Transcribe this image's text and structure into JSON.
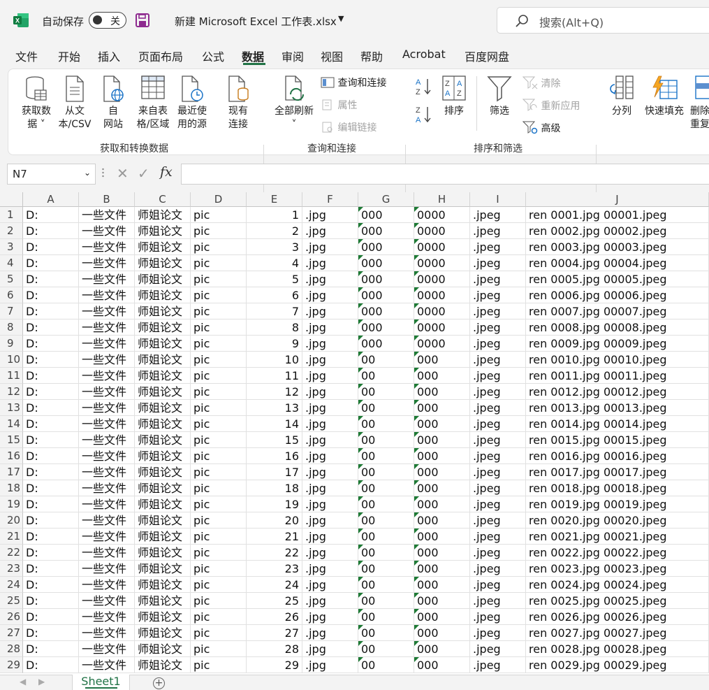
{
  "titlebar": {
    "autosave_label": "自动保存",
    "toggle_state": "关",
    "doc_title": "新建 Microsoft Excel 工作表.xlsx",
    "search_placeholder": "搜索(Alt+Q)",
    "brand_color": "#217346"
  },
  "ribbon_tabs": [
    "文件",
    "开始",
    "插入",
    "页面布局",
    "公式",
    "数据",
    "审阅",
    "视图",
    "帮助",
    "Acrobat",
    "百度网盘"
  ],
  "active_tab": "数据",
  "ribbon": {
    "get_data": [
      "获取数",
      "据 ˅"
    ],
    "from_csv": [
      "从文",
      "本/CSV"
    ],
    "from_web": [
      "自",
      "网站"
    ],
    "from_table": [
      "来自表",
      "格/区域"
    ],
    "recent_sources": [
      "最近使",
      "用的源"
    ],
    "existing_conn": [
      "现有",
      "连接"
    ],
    "group1": "获取和转换数据",
    "refresh_all": [
      "全部刷新",
      "˅"
    ],
    "queries_conn": "查询和连接",
    "properties": "属性",
    "edit_links": "编辑链接",
    "group2": "查询和连接",
    "sort": "排序",
    "filter": "筛选",
    "clear": "清除",
    "reapply": "重新应用",
    "advanced": "高级",
    "group3": "排序和筛选",
    "split": "分列",
    "flash_fill": "快速填充",
    "remove_dup": [
      "删除",
      "重复"
    ]
  },
  "formula_bar": {
    "name_box": "N7",
    "fx": "fx",
    "formula": ""
  },
  "sheet": {
    "columns": [
      "A",
      "B",
      "C",
      "D",
      "E",
      "F",
      "G",
      "H",
      "I",
      "J"
    ],
    "rows": [
      {
        "n": "1",
        "a": "D:",
        "b": "一些文件",
        "c": "师姐论文",
        "d": "pic",
        "e": "1",
        "f": ".jpg",
        "g": "000",
        "h": "0000",
        "i": ".jpeg",
        "j": "ren 0001.jpg 00001.jpeg"
      },
      {
        "n": "2",
        "a": "D:",
        "b": "一些文件",
        "c": "师姐论文",
        "d": "pic",
        "e": "2",
        "f": ".jpg",
        "g": "000",
        "h": "0000",
        "i": ".jpeg",
        "j": "ren 0002.jpg 00002.jpeg"
      },
      {
        "n": "3",
        "a": "D:",
        "b": "一些文件",
        "c": "师姐论文",
        "d": "pic",
        "e": "3",
        "f": ".jpg",
        "g": "000",
        "h": "0000",
        "i": ".jpeg",
        "j": "ren 0003.jpg 00003.jpeg"
      },
      {
        "n": "4",
        "a": "D:",
        "b": "一些文件",
        "c": "师姐论文",
        "d": "pic",
        "e": "4",
        "f": ".jpg",
        "g": "000",
        "h": "0000",
        "i": ".jpeg",
        "j": "ren 0004.jpg 00004.jpeg"
      },
      {
        "n": "5",
        "a": "D:",
        "b": "一些文件",
        "c": "师姐论文",
        "d": "pic",
        "e": "5",
        "f": ".jpg",
        "g": "000",
        "h": "0000",
        "i": ".jpeg",
        "j": "ren 0005.jpg 00005.jpeg"
      },
      {
        "n": "6",
        "a": "D:",
        "b": "一些文件",
        "c": "师姐论文",
        "d": "pic",
        "e": "6",
        "f": ".jpg",
        "g": "000",
        "h": "0000",
        "i": ".jpeg",
        "j": "ren 0006.jpg 00006.jpeg"
      },
      {
        "n": "7",
        "a": "D:",
        "b": "一些文件",
        "c": "师姐论文",
        "d": "pic",
        "e": "7",
        "f": ".jpg",
        "g": "000",
        "h": "0000",
        "i": ".jpeg",
        "j": "ren 0007.jpg 00007.jpeg"
      },
      {
        "n": "8",
        "a": "D:",
        "b": "一些文件",
        "c": "师姐论文",
        "d": "pic",
        "e": "8",
        "f": ".jpg",
        "g": "000",
        "h": "0000",
        "i": ".jpeg",
        "j": "ren 0008.jpg 00008.jpeg"
      },
      {
        "n": "9",
        "a": "D:",
        "b": "一些文件",
        "c": "师姐论文",
        "d": "pic",
        "e": "9",
        "f": ".jpg",
        "g": "000",
        "h": "0000",
        "i": ".jpeg",
        "j": "ren 0009.jpg 00009.jpeg"
      },
      {
        "n": "10",
        "a": "D:",
        "b": "一些文件",
        "c": "师姐论文",
        "d": "pic",
        "e": "10",
        "f": ".jpg",
        "g": "00",
        "h": "000",
        "i": ".jpeg",
        "j": "ren 0010.jpg 00010.jpeg"
      },
      {
        "n": "11",
        "a": "D:",
        "b": "一些文件",
        "c": "师姐论文",
        "d": "pic",
        "e": "11",
        "f": ".jpg",
        "g": "00",
        "h": "000",
        "i": ".jpeg",
        "j": "ren 0011.jpg 00011.jpeg"
      },
      {
        "n": "12",
        "a": "D:",
        "b": "一些文件",
        "c": "师姐论文",
        "d": "pic",
        "e": "12",
        "f": ".jpg",
        "g": "00",
        "h": "000",
        "i": ".jpeg",
        "j": "ren 0012.jpg 00012.jpeg"
      },
      {
        "n": "13",
        "a": "D:",
        "b": "一些文件",
        "c": "师姐论文",
        "d": "pic",
        "e": "13",
        "f": ".jpg",
        "g": "00",
        "h": "000",
        "i": ".jpeg",
        "j": "ren 0013.jpg 00013.jpeg"
      },
      {
        "n": "14",
        "a": "D:",
        "b": "一些文件",
        "c": "师姐论文",
        "d": "pic",
        "e": "14",
        "f": ".jpg",
        "g": "00",
        "h": "000",
        "i": ".jpeg",
        "j": "ren 0014.jpg 00014.jpeg"
      },
      {
        "n": "15",
        "a": "D:",
        "b": "一些文件",
        "c": "师姐论文",
        "d": "pic",
        "e": "15",
        "f": ".jpg",
        "g": "00",
        "h": "000",
        "i": ".jpeg",
        "j": "ren 0015.jpg 00015.jpeg"
      },
      {
        "n": "16",
        "a": "D:",
        "b": "一些文件",
        "c": "师姐论文",
        "d": "pic",
        "e": "16",
        "f": ".jpg",
        "g": "00",
        "h": "000",
        "i": ".jpeg",
        "j": "ren 0016.jpg 00016.jpeg"
      },
      {
        "n": "17",
        "a": "D:",
        "b": "一些文件",
        "c": "师姐论文",
        "d": "pic",
        "e": "17",
        "f": ".jpg",
        "g": "00",
        "h": "000",
        "i": ".jpeg",
        "j": "ren 0017.jpg 00017.jpeg"
      },
      {
        "n": "18",
        "a": "D:",
        "b": "一些文件",
        "c": "师姐论文",
        "d": "pic",
        "e": "18",
        "f": ".jpg",
        "g": "00",
        "h": "000",
        "i": ".jpeg",
        "j": "ren 0018.jpg 00018.jpeg"
      },
      {
        "n": "19",
        "a": "D:",
        "b": "一些文件",
        "c": "师姐论文",
        "d": "pic",
        "e": "19",
        "f": ".jpg",
        "g": "00",
        "h": "000",
        "i": ".jpeg",
        "j": "ren 0019.jpg 00019.jpeg"
      },
      {
        "n": "20",
        "a": "D:",
        "b": "一些文件",
        "c": "师姐论文",
        "d": "pic",
        "e": "20",
        "f": ".jpg",
        "g": "00",
        "h": "000",
        "i": ".jpeg",
        "j": "ren 0020.jpg 00020.jpeg"
      },
      {
        "n": "21",
        "a": "D:",
        "b": "一些文件",
        "c": "师姐论文",
        "d": "pic",
        "e": "21",
        "f": ".jpg",
        "g": "00",
        "h": "000",
        "i": ".jpeg",
        "j": "ren 0021.jpg 00021.jpeg"
      },
      {
        "n": "22",
        "a": "D:",
        "b": "一些文件",
        "c": "师姐论文",
        "d": "pic",
        "e": "22",
        "f": ".jpg",
        "g": "00",
        "h": "000",
        "i": ".jpeg",
        "j": "ren 0022.jpg 00022.jpeg"
      },
      {
        "n": "23",
        "a": "D:",
        "b": "一些文件",
        "c": "师姐论文",
        "d": "pic",
        "e": "23",
        "f": ".jpg",
        "g": "00",
        "h": "000",
        "i": ".jpeg",
        "j": "ren 0023.jpg 00023.jpeg"
      },
      {
        "n": "24",
        "a": "D:",
        "b": "一些文件",
        "c": "师姐论文",
        "d": "pic",
        "e": "24",
        "f": ".jpg",
        "g": "00",
        "h": "000",
        "i": ".jpeg",
        "j": "ren 0024.jpg 00024.jpeg"
      },
      {
        "n": "25",
        "a": "D:",
        "b": "一些文件",
        "c": "师姐论文",
        "d": "pic",
        "e": "25",
        "f": ".jpg",
        "g": "00",
        "h": "000",
        "i": ".jpeg",
        "j": "ren 0025.jpg 00025.jpeg"
      },
      {
        "n": "26",
        "a": "D:",
        "b": "一些文件",
        "c": "师姐论文",
        "d": "pic",
        "e": "26",
        "f": ".jpg",
        "g": "00",
        "h": "000",
        "i": ".jpeg",
        "j": "ren 0026.jpg 00026.jpeg"
      },
      {
        "n": "27",
        "a": "D:",
        "b": "一些文件",
        "c": "师姐论文",
        "d": "pic",
        "e": "27",
        "f": ".jpg",
        "g": "00",
        "h": "000",
        "i": ".jpeg",
        "j": "ren 0027.jpg 00027.jpeg"
      },
      {
        "n": "28",
        "a": "D:",
        "b": "一些文件",
        "c": "师姐论文",
        "d": "pic",
        "e": "28",
        "f": ".jpg",
        "g": "00",
        "h": "000",
        "i": ".jpeg",
        "j": "ren 0028.jpg 00028.jpeg"
      },
      {
        "n": "29",
        "a": "D:",
        "b": "一些文件",
        "c": "师姐论文",
        "d": "pic",
        "e": "29",
        "f": ".jpg",
        "g": "00",
        "h": "000",
        "i": ".jpeg",
        "j": "ren 0029.jpg 00029.jpeg"
      }
    ],
    "sheet_tab": "Sheet1",
    "active_cell": "N7"
  }
}
